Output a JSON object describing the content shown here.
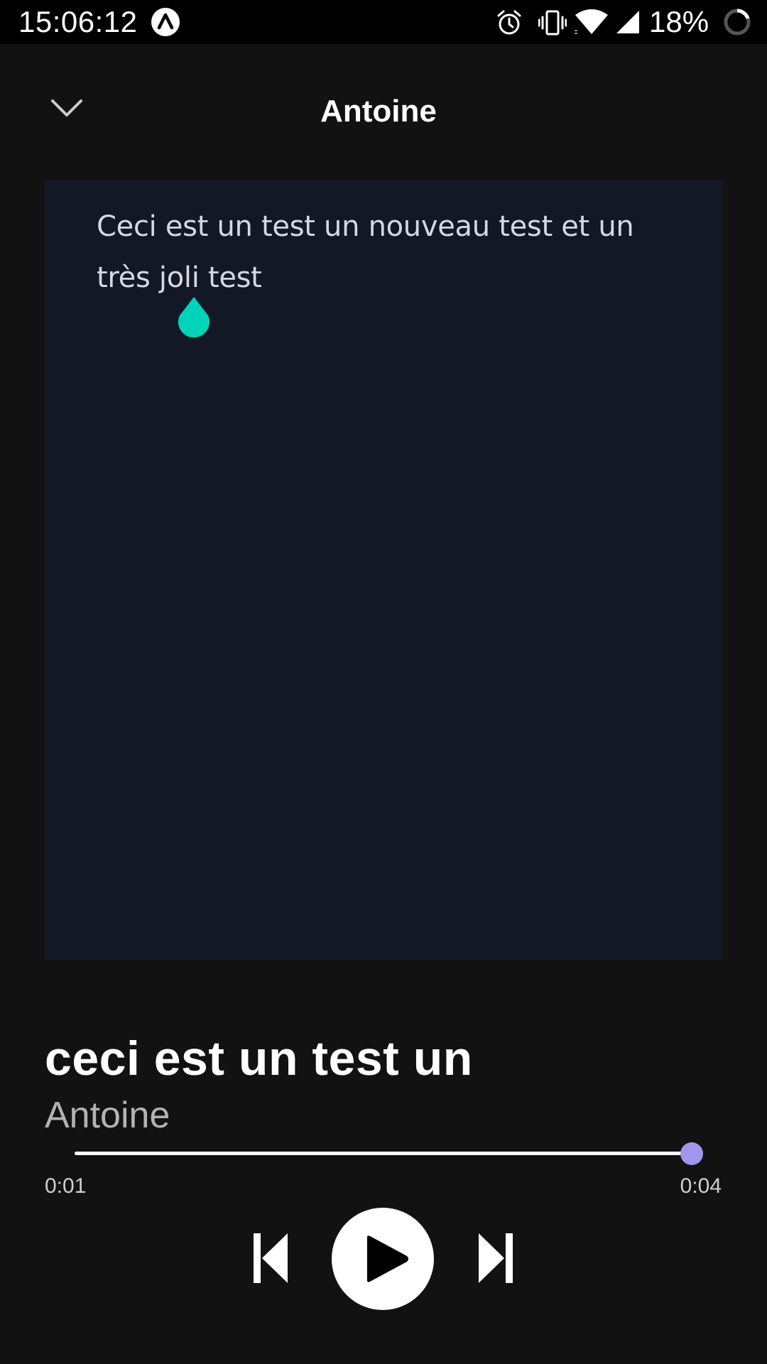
{
  "status_bar": {
    "time": "15:06:12",
    "battery": "18%",
    "icons": [
      "app-icon",
      "alarm-icon",
      "vibrate-icon",
      "wifi-icon",
      "signal-icon",
      "battery-ring-icon"
    ]
  },
  "header": {
    "title": "Antoine",
    "collapse_icon": "chevron-down-icon"
  },
  "lyrics": {
    "text": "Ceci est un test un nouveau test et un très joli test",
    "cursor_color": "#00d3b8"
  },
  "track": {
    "title": "ceci est un test un",
    "artist": "Antoine"
  },
  "progress": {
    "elapsed": "0:01",
    "total": "0:04",
    "fraction": 1.0,
    "thumb_color": "#a195ec"
  },
  "controls": {
    "prev_icon": "skip-previous-icon",
    "play_icon": "play-icon",
    "next_icon": "skip-next-icon"
  },
  "colors": {
    "background": "#121212",
    "panel": "#131827",
    "accent": "#a195ec"
  }
}
